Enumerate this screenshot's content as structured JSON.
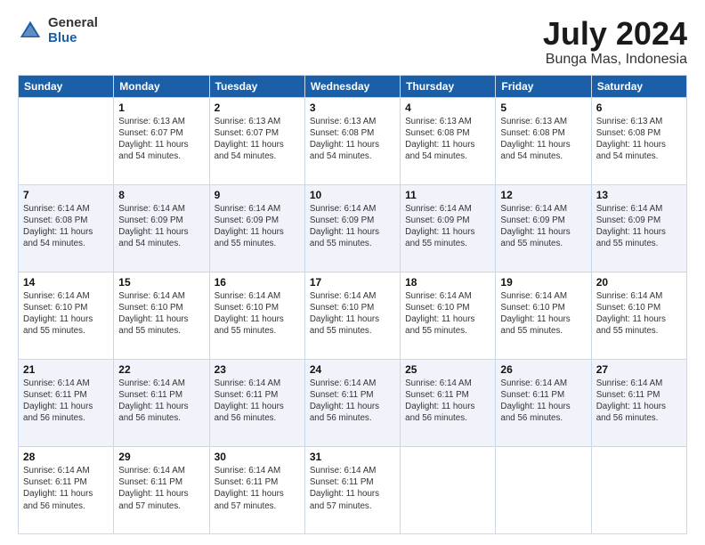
{
  "header": {
    "logo_general": "General",
    "logo_blue": "Blue",
    "month_title": "July 2024",
    "location": "Bunga Mas, Indonesia"
  },
  "days_of_week": [
    "Sunday",
    "Monday",
    "Tuesday",
    "Wednesday",
    "Thursday",
    "Friday",
    "Saturday"
  ],
  "weeks": [
    [
      {
        "day": "",
        "info": ""
      },
      {
        "day": "1",
        "info": "Sunrise: 6:13 AM\nSunset: 6:07 PM\nDaylight: 11 hours\nand 54 minutes."
      },
      {
        "day": "2",
        "info": "Sunrise: 6:13 AM\nSunset: 6:07 PM\nDaylight: 11 hours\nand 54 minutes."
      },
      {
        "day": "3",
        "info": "Sunrise: 6:13 AM\nSunset: 6:08 PM\nDaylight: 11 hours\nand 54 minutes."
      },
      {
        "day": "4",
        "info": "Sunrise: 6:13 AM\nSunset: 6:08 PM\nDaylight: 11 hours\nand 54 minutes."
      },
      {
        "day": "5",
        "info": "Sunrise: 6:13 AM\nSunset: 6:08 PM\nDaylight: 11 hours\nand 54 minutes."
      },
      {
        "day": "6",
        "info": "Sunrise: 6:13 AM\nSunset: 6:08 PM\nDaylight: 11 hours\nand 54 minutes."
      }
    ],
    [
      {
        "day": "7",
        "info": "Sunrise: 6:14 AM\nSunset: 6:08 PM\nDaylight: 11 hours\nand 54 minutes."
      },
      {
        "day": "8",
        "info": "Sunrise: 6:14 AM\nSunset: 6:09 PM\nDaylight: 11 hours\nand 54 minutes."
      },
      {
        "day": "9",
        "info": "Sunrise: 6:14 AM\nSunset: 6:09 PM\nDaylight: 11 hours\nand 55 minutes."
      },
      {
        "day": "10",
        "info": "Sunrise: 6:14 AM\nSunset: 6:09 PM\nDaylight: 11 hours\nand 55 minutes."
      },
      {
        "day": "11",
        "info": "Sunrise: 6:14 AM\nSunset: 6:09 PM\nDaylight: 11 hours\nand 55 minutes."
      },
      {
        "day": "12",
        "info": "Sunrise: 6:14 AM\nSunset: 6:09 PM\nDaylight: 11 hours\nand 55 minutes."
      },
      {
        "day": "13",
        "info": "Sunrise: 6:14 AM\nSunset: 6:09 PM\nDaylight: 11 hours\nand 55 minutes."
      }
    ],
    [
      {
        "day": "14",
        "info": "Sunrise: 6:14 AM\nSunset: 6:10 PM\nDaylight: 11 hours\nand 55 minutes."
      },
      {
        "day": "15",
        "info": "Sunrise: 6:14 AM\nSunset: 6:10 PM\nDaylight: 11 hours\nand 55 minutes."
      },
      {
        "day": "16",
        "info": "Sunrise: 6:14 AM\nSunset: 6:10 PM\nDaylight: 11 hours\nand 55 minutes."
      },
      {
        "day": "17",
        "info": "Sunrise: 6:14 AM\nSunset: 6:10 PM\nDaylight: 11 hours\nand 55 minutes."
      },
      {
        "day": "18",
        "info": "Sunrise: 6:14 AM\nSunset: 6:10 PM\nDaylight: 11 hours\nand 55 minutes."
      },
      {
        "day": "19",
        "info": "Sunrise: 6:14 AM\nSunset: 6:10 PM\nDaylight: 11 hours\nand 55 minutes."
      },
      {
        "day": "20",
        "info": "Sunrise: 6:14 AM\nSunset: 6:10 PM\nDaylight: 11 hours\nand 55 minutes."
      }
    ],
    [
      {
        "day": "21",
        "info": "Sunrise: 6:14 AM\nSunset: 6:11 PM\nDaylight: 11 hours\nand 56 minutes."
      },
      {
        "day": "22",
        "info": "Sunrise: 6:14 AM\nSunset: 6:11 PM\nDaylight: 11 hours\nand 56 minutes."
      },
      {
        "day": "23",
        "info": "Sunrise: 6:14 AM\nSunset: 6:11 PM\nDaylight: 11 hours\nand 56 minutes."
      },
      {
        "day": "24",
        "info": "Sunrise: 6:14 AM\nSunset: 6:11 PM\nDaylight: 11 hours\nand 56 minutes."
      },
      {
        "day": "25",
        "info": "Sunrise: 6:14 AM\nSunset: 6:11 PM\nDaylight: 11 hours\nand 56 minutes."
      },
      {
        "day": "26",
        "info": "Sunrise: 6:14 AM\nSunset: 6:11 PM\nDaylight: 11 hours\nand 56 minutes."
      },
      {
        "day": "27",
        "info": "Sunrise: 6:14 AM\nSunset: 6:11 PM\nDaylight: 11 hours\nand 56 minutes."
      }
    ],
    [
      {
        "day": "28",
        "info": "Sunrise: 6:14 AM\nSunset: 6:11 PM\nDaylight: 11 hours\nand 56 minutes."
      },
      {
        "day": "29",
        "info": "Sunrise: 6:14 AM\nSunset: 6:11 PM\nDaylight: 11 hours\nand 57 minutes."
      },
      {
        "day": "30",
        "info": "Sunrise: 6:14 AM\nSunset: 6:11 PM\nDaylight: 11 hours\nand 57 minutes."
      },
      {
        "day": "31",
        "info": "Sunrise: 6:14 AM\nSunset: 6:11 PM\nDaylight: 11 hours\nand 57 minutes."
      },
      {
        "day": "",
        "info": ""
      },
      {
        "day": "",
        "info": ""
      },
      {
        "day": "",
        "info": ""
      }
    ]
  ]
}
